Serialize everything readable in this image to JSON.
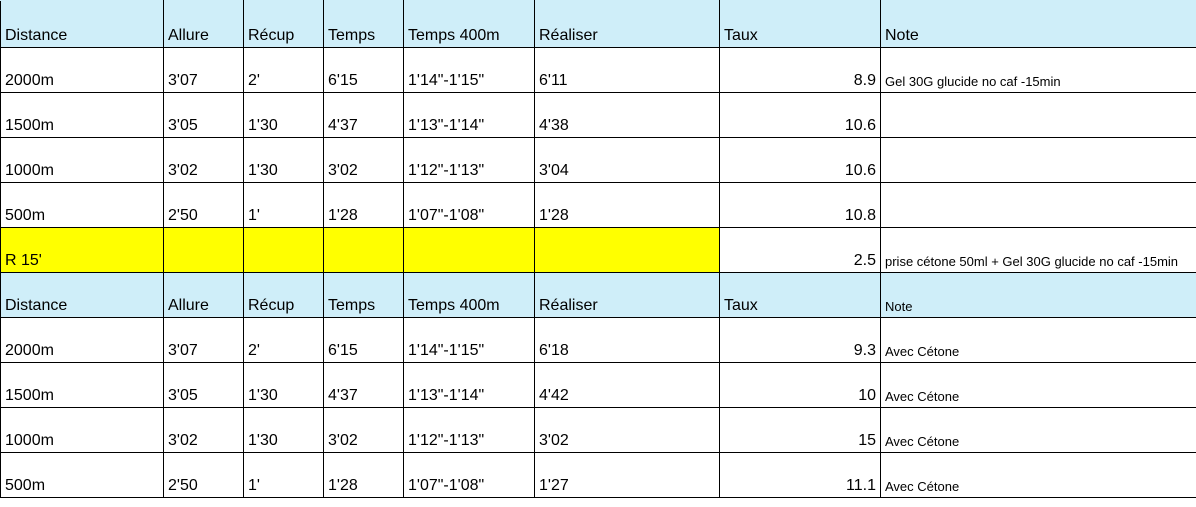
{
  "table": {
    "header1": [
      "Distance",
      "Allure",
      "Récup",
      "Temps",
      "Temps 400m",
      "Réaliser",
      "Taux",
      "Note"
    ],
    "rows1": [
      [
        "2000m",
        "3'07",
        "2'",
        "6'15",
        "1'14\"-1'15\"",
        "6'11",
        "8.9",
        "Gel 30G glucide no caf -15min"
      ],
      [
        "1500m",
        "3'05",
        "1'30",
        "4'37",
        "1'13\"-1'14\"",
        "4'38",
        "10.6",
        ""
      ],
      [
        "1000m",
        "3'02",
        "1'30",
        "3'02",
        "1'12\"-1'13\"",
        "3'04",
        "10.6",
        ""
      ],
      [
        "500m",
        "2'50",
        "1'",
        "1'28",
        "1'07\"-1'08\"",
        "1'28",
        "10.8",
        ""
      ]
    ],
    "separator": {
      "label": "R 15'",
      "taux": "2.5",
      "note": "prise cétone 50ml + Gel 30G glucide no caf -15min",
      "highlight_color": "#ffff00"
    },
    "header2": [
      "Distance",
      "Allure",
      "Récup",
      "Temps",
      "Temps 400m",
      "Réaliser",
      "Taux",
      "Note"
    ],
    "rows2": [
      [
        "2000m",
        "3'07",
        "2'",
        "6'15",
        "1'14\"-1'15\"",
        "6'18",
        "9.3",
        "Avec Cétone"
      ],
      [
        "1500m",
        "3'05",
        "1'30",
        "4'37",
        "1'13\"-1'14\"",
        "4'42",
        "10",
        "Avec Cétone"
      ],
      [
        "1000m",
        "3'02",
        "1'30",
        "3'02",
        "1'12\"-1'13\"",
        "3'02",
        "15",
        "Avec Cétone"
      ],
      [
        "500m",
        "2'50",
        "1'",
        "1'28",
        "1'07\"-1'08\"",
        "1'27",
        "11.1",
        "Avec Cétone"
      ]
    ],
    "header_color": "#cfeef9"
  }
}
